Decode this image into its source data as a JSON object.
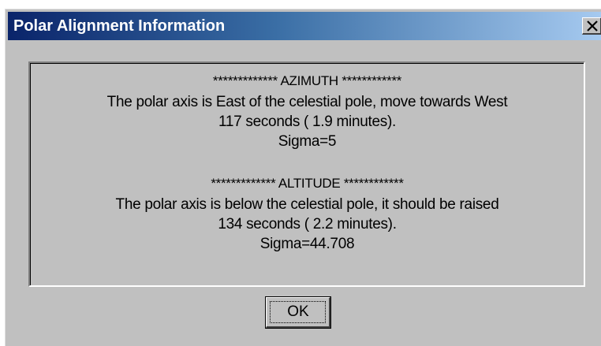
{
  "window": {
    "title": "Polar Alignment Information",
    "close_icon": "close-icon"
  },
  "azimuth": {
    "header": "************* AZIMUTH ************",
    "direction": "The polar axis is East of the celestial pole, move towards West",
    "amount": "117 seconds (  1.9 minutes).",
    "sigma": "Sigma=5"
  },
  "altitude": {
    "header": "************* ALTITUDE ************",
    "direction": "The polar axis is below the celestial pole, it should be raised",
    "amount": "134 seconds (  2.2 minutes).",
    "sigma": "Sigma=44.708"
  },
  "buttons": {
    "ok_label": "OK"
  }
}
